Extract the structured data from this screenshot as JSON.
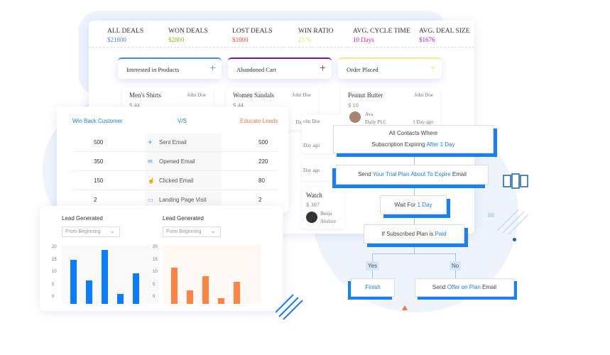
{
  "stats": [
    {
      "label": "ALL DEALS",
      "value": "$21800",
      "color": "#4f7ff0"
    },
    {
      "label": "WON DEALS",
      "value": "$2800",
      "color": "#7cc423"
    },
    {
      "label": "LOST DEALS",
      "value": "$1000",
      "color": "#f0453a"
    },
    {
      "label": "WIN RATIO",
      "value": "23 %",
      "color": "#e4e35a"
    },
    {
      "label": "AVG. CYCLE TIME",
      "value": "10 Days",
      "color": "#f01a9a"
    },
    {
      "label": "AVG. DEAL SIZE",
      "value": "$1676",
      "color": "#b21ae0"
    }
  ],
  "columns": [
    {
      "title": "Interested in Products",
      "plus": "+",
      "color": "#3f8ef5"
    },
    {
      "title": "Abandoned Cart",
      "plus": "+",
      "color": "#7a12b8"
    },
    {
      "title": "Order Placed",
      "plus": "+",
      "color": "#eeec8a"
    }
  ],
  "deals": [
    {
      "name": "Men's Shirts",
      "owner": "John Doe",
      "price": "$ 44"
    },
    {
      "name": "Women Sandals",
      "owner": "John Doe",
      "price": "$ 44",
      "time": "Day ago"
    },
    {
      "name": "Peanut Butter",
      "owner": "John Doe",
      "price": "$ 10",
      "contact": "Ava",
      "company": "Daily PLC",
      "time": "1 Day ago"
    }
  ],
  "hidden_cards": [
    {
      "owner": "ohn Doe",
      "time": "Day ago"
    },
    {
      "time": "Day ago"
    },
    {
      "name": "Watch",
      "price": "$ 307",
      "contact": "Benja",
      "company": "Abshire"
    }
  ],
  "compare": {
    "left": "Win Back Customer",
    "mid": "V/S",
    "right": "Educate Leads",
    "rows": [
      {
        "a": "500",
        "metric": "Sent Email",
        "icon": "paper-plane-icon",
        "b": "500"
      },
      {
        "a": "350",
        "metric": "Opened Email",
        "icon": "open-mail-icon",
        "b": "220"
      },
      {
        "a": "150",
        "metric": "Clicked Email",
        "icon": "click-icon",
        "b": "80"
      },
      {
        "a": "2",
        "metric": "Landing Page Visit",
        "icon": "browser-icon",
        "b": "2"
      }
    ]
  },
  "chart_data": [
    {
      "type": "bar",
      "title": "Lead Generated",
      "filter": "From Beginning",
      "yticks": [
        "20",
        "15",
        "10",
        "5",
        "0"
      ],
      "ylim": [
        0,
        20
      ],
      "values": [
        16,
        8.5,
        19.5,
        3.5,
        11
      ],
      "color": "#0a7cff"
    },
    {
      "type": "bar",
      "title": "Lead Generated",
      "filter": "From Beginning",
      "yticks": [
        "20",
        "15",
        "10",
        "5",
        "0"
      ],
      "ylim": [
        0,
        20
      ],
      "values": [
        13,
        5,
        10,
        2,
        8
      ],
      "color": "#ff8444"
    }
  ],
  "flow": {
    "start": {
      "line1": "All Contacts Where",
      "pre": "Subscription Expiring ",
      "hl": "After 1 Day"
    },
    "send": {
      "pre": "Send ",
      "hl": "Your Trial Plan About To Expire",
      "post": " Email"
    },
    "wait": {
      "pre": "Wait For ",
      "hl": "1 Day"
    },
    "cond": {
      "pre": "If Subscribed Plan is ",
      "hl": "Paid"
    },
    "yes": "Yes",
    "no": "No",
    "finish": "Finish",
    "offer": {
      "pre": "Send ",
      "hl": "Offer on Plan",
      "post": " Email"
    }
  }
}
